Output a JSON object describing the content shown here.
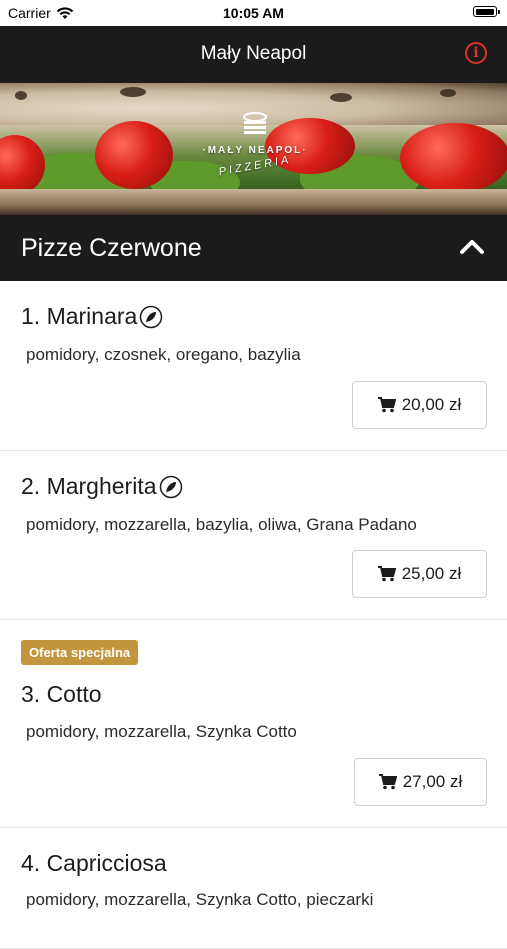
{
  "status_bar": {
    "carrier": "Carrier",
    "time": "10:05 AM",
    "icons": [
      "wifi-icon",
      "battery-icon"
    ]
  },
  "nav": {
    "title": "Mały Neapol",
    "info_icon": "info-icon",
    "accent_color": "#e0312b"
  },
  "hero": {
    "logo_line1": "·MAŁY NEAPOL·",
    "logo_line2": "PIZZERIA"
  },
  "category": {
    "title": "Pizze Czerwone",
    "toggle_icon": "chevron-up-icon"
  },
  "items": [
    {
      "name": "1. Marinara",
      "icon": "leaf-icon",
      "description": "pomidory, czosnek, oregano, bazylia",
      "price": "20,00 zł",
      "badge": ""
    },
    {
      "name": "2. Margherita",
      "icon": "leaf-icon",
      "description": "pomidory, mozzarella, bazylia, oliwa, Grana Padano",
      "price": "25,00 zł",
      "badge": ""
    },
    {
      "name": "3. Cotto",
      "icon": "",
      "description": "pomidory, mozzarella, Szynka Cotto",
      "price": "27,00 zł",
      "badge": "Oferta specjalna"
    },
    {
      "name": "4. Capricciosa",
      "icon": "",
      "description": "pomidory, mozzarella, Szynka Cotto, pieczarki",
      "price": "",
      "badge": ""
    }
  ],
  "colors": {
    "dark_bar": "#1b1b1b",
    "badge": "#c3953c"
  }
}
